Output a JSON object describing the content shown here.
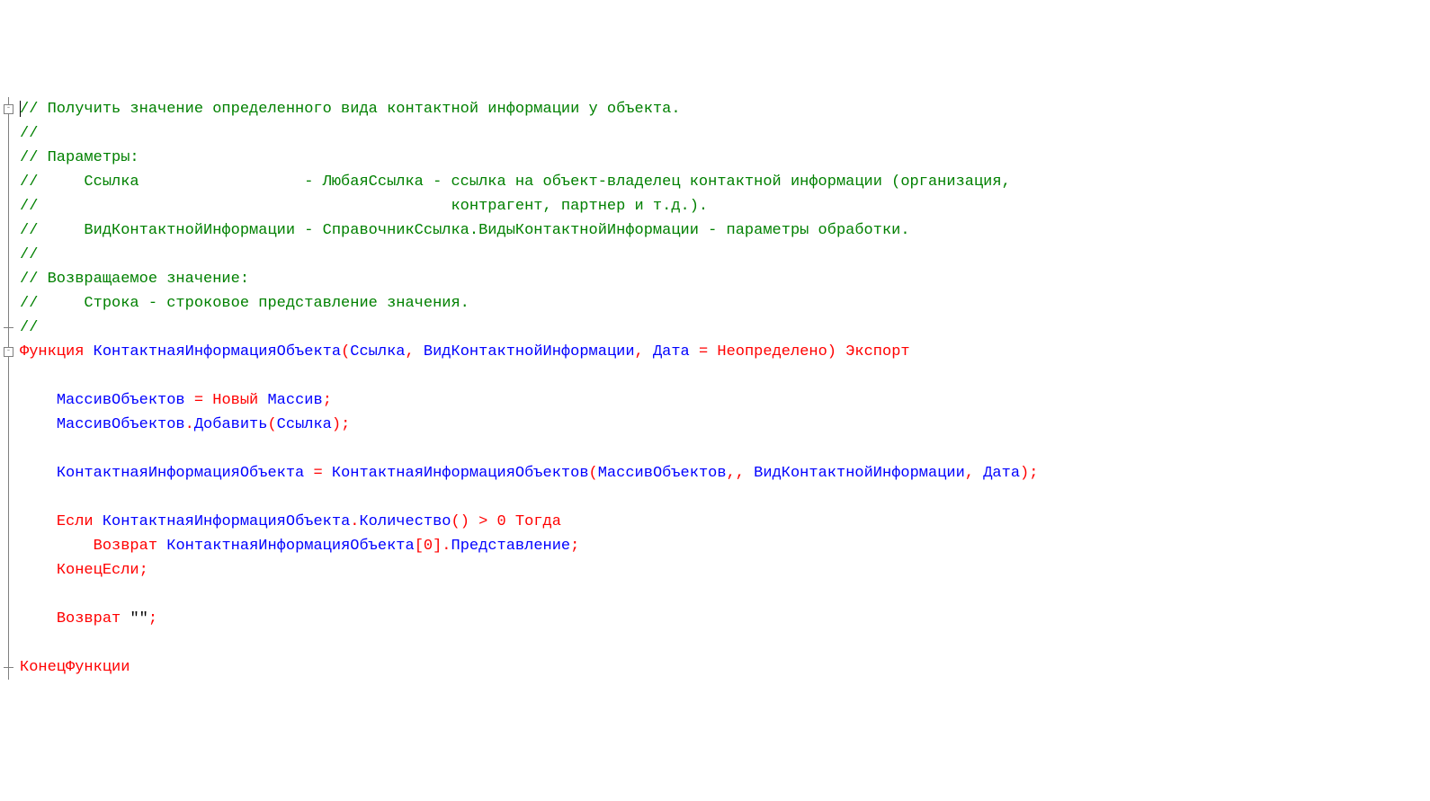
{
  "syntax": {
    "colors": {
      "comment": "#008000",
      "keyword": "#ff0000",
      "identifier": "#0000ff",
      "punctuation": "#ff0000",
      "number": "#ff0000",
      "string": "#000000"
    }
  },
  "fold_markers": [
    {
      "row": 0,
      "type": "collapse"
    },
    {
      "row": 9,
      "type": "end"
    },
    {
      "row": 10,
      "type": "collapse"
    },
    {
      "row": 23,
      "type": "end"
    }
  ],
  "code_lines": [
    {
      "row": 0,
      "spans": [
        {
          "cls": "c-cmt",
          "t": "// Получить значение определенного вида контактной информации у объекта."
        }
      ]
    },
    {
      "row": 1,
      "spans": [
        {
          "cls": "c-cmt",
          "t": "//"
        }
      ]
    },
    {
      "row": 2,
      "spans": [
        {
          "cls": "c-cmt",
          "t": "// Параметры:"
        }
      ]
    },
    {
      "row": 3,
      "spans": [
        {
          "cls": "c-cmt",
          "t": "//     Ссылка                  - ЛюбаяСсылка - ссылка на объект-владелец контактной информации (организация,"
        }
      ]
    },
    {
      "row": 4,
      "spans": [
        {
          "cls": "c-cmt",
          "t": "//                                             контрагент, партнер и т.д.)."
        }
      ]
    },
    {
      "row": 5,
      "spans": [
        {
          "cls": "c-cmt",
          "t": "//     ВидКонтактнойИнформации - СправочникСсылка.ВидыКонтактнойИнформации - параметры обработки."
        }
      ]
    },
    {
      "row": 6,
      "spans": [
        {
          "cls": "c-cmt",
          "t": "//"
        }
      ]
    },
    {
      "row": 7,
      "spans": [
        {
          "cls": "c-cmt",
          "t": "// Возвращаемое значение:"
        }
      ]
    },
    {
      "row": 8,
      "spans": [
        {
          "cls": "c-cmt",
          "t": "//     Строка - строковое представление значения."
        }
      ]
    },
    {
      "row": 9,
      "spans": [
        {
          "cls": "c-cmt",
          "t": "//"
        }
      ]
    },
    {
      "row": 10,
      "spans": [
        {
          "cls": "c-kw",
          "t": "Функция "
        },
        {
          "cls": "c-id",
          "t": "КонтактнаяИнформацияОбъекта"
        },
        {
          "cls": "c-punc",
          "t": "("
        },
        {
          "cls": "c-id",
          "t": "Ссылка"
        },
        {
          "cls": "c-punc",
          "t": ", "
        },
        {
          "cls": "c-id",
          "t": "ВидКонтактнойИнформации"
        },
        {
          "cls": "c-punc",
          "t": ", "
        },
        {
          "cls": "c-id",
          "t": "Дата"
        },
        {
          "cls": "c-punc",
          "t": " = "
        },
        {
          "cls": "c-kw",
          "t": "Неопределено"
        },
        {
          "cls": "c-punc",
          "t": ") "
        },
        {
          "cls": "c-kw",
          "t": "Экспорт"
        }
      ]
    },
    {
      "row": 11,
      "spans": [
        {
          "cls": "",
          "t": "    "
        }
      ]
    },
    {
      "row": 12,
      "spans": [
        {
          "cls": "",
          "t": "    "
        },
        {
          "cls": "c-id",
          "t": "МассивОбъектов"
        },
        {
          "cls": "c-punc",
          "t": " = "
        },
        {
          "cls": "c-kw",
          "t": "Новый "
        },
        {
          "cls": "c-id",
          "t": "Массив"
        },
        {
          "cls": "c-punc",
          "t": ";"
        }
      ]
    },
    {
      "row": 13,
      "spans": [
        {
          "cls": "",
          "t": "    "
        },
        {
          "cls": "c-id",
          "t": "МассивОбъектов"
        },
        {
          "cls": "c-punc",
          "t": "."
        },
        {
          "cls": "c-id",
          "t": "Добавить"
        },
        {
          "cls": "c-punc",
          "t": "("
        },
        {
          "cls": "c-id",
          "t": "Ссылка"
        },
        {
          "cls": "c-punc",
          "t": ");"
        }
      ]
    },
    {
      "row": 14,
      "spans": [
        {
          "cls": "",
          "t": "    "
        }
      ]
    },
    {
      "row": 15,
      "spans": [
        {
          "cls": "",
          "t": "    "
        },
        {
          "cls": "c-id",
          "t": "КонтактнаяИнформацияОбъекта"
        },
        {
          "cls": "c-punc",
          "t": " = "
        },
        {
          "cls": "c-id",
          "t": "КонтактнаяИнформацияОбъектов"
        },
        {
          "cls": "c-punc",
          "t": "("
        },
        {
          "cls": "c-id",
          "t": "МассивОбъектов"
        },
        {
          "cls": "c-punc",
          "t": ",, "
        },
        {
          "cls": "c-id",
          "t": "ВидКонтактнойИнформации"
        },
        {
          "cls": "c-punc",
          "t": ", "
        },
        {
          "cls": "c-id",
          "t": "Дата"
        },
        {
          "cls": "c-punc",
          "t": ");"
        }
      ]
    },
    {
      "row": 16,
      "spans": [
        {
          "cls": "",
          "t": "    "
        }
      ]
    },
    {
      "row": 17,
      "spans": [
        {
          "cls": "",
          "t": "    "
        },
        {
          "cls": "c-kw",
          "t": "Если "
        },
        {
          "cls": "c-id",
          "t": "КонтактнаяИнформацияОбъекта"
        },
        {
          "cls": "c-punc",
          "t": "."
        },
        {
          "cls": "c-id",
          "t": "Количество"
        },
        {
          "cls": "c-punc",
          "t": "() > "
        },
        {
          "cls": "c-num",
          "t": "0"
        },
        {
          "cls": "c-kw",
          "t": " Тогда"
        }
      ]
    },
    {
      "row": 18,
      "spans": [
        {
          "cls": "",
          "t": "        "
        },
        {
          "cls": "c-kw",
          "t": "Возврат "
        },
        {
          "cls": "c-id",
          "t": "КонтактнаяИнформацияОбъекта"
        },
        {
          "cls": "c-punc",
          "t": "["
        },
        {
          "cls": "c-num",
          "t": "0"
        },
        {
          "cls": "c-punc",
          "t": "]."
        },
        {
          "cls": "c-id",
          "t": "Представление"
        },
        {
          "cls": "c-punc",
          "t": ";"
        }
      ]
    },
    {
      "row": 19,
      "spans": [
        {
          "cls": "",
          "t": "    "
        },
        {
          "cls": "c-kw",
          "t": "КонецЕсли"
        },
        {
          "cls": "c-punc",
          "t": ";"
        }
      ]
    },
    {
      "row": 20,
      "spans": [
        {
          "cls": "",
          "t": "    "
        }
      ]
    },
    {
      "row": 21,
      "spans": [
        {
          "cls": "",
          "t": "    "
        },
        {
          "cls": "c-kw",
          "t": "Возврат "
        },
        {
          "cls": "c-str",
          "t": "\"\""
        },
        {
          "cls": "c-punc",
          "t": ";"
        }
      ]
    },
    {
      "row": 22,
      "spans": [
        {
          "cls": "",
          "t": "    "
        }
      ]
    },
    {
      "row": 23,
      "spans": [
        {
          "cls": "c-kw",
          "t": "КонецФункции"
        }
      ]
    }
  ],
  "caret_row": 0
}
